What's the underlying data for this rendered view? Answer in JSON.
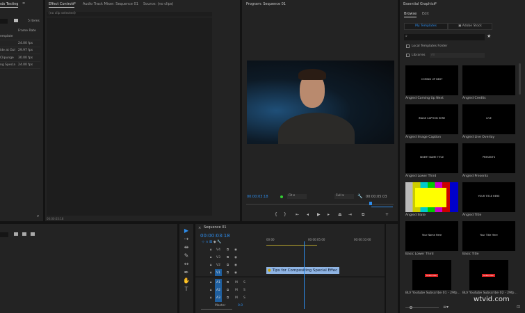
{
  "project": {
    "title": "Pinds Testing",
    "items_count": "5 items",
    "column_frame_rate": "Frame Rate",
    "rows": [
      {
        "name": "emplate",
        "fps": ""
      },
      {
        "name": "",
        "fps": "24.00 fps"
      },
      {
        "name": "ide at Gol",
        "fps": "29.97 fps"
      },
      {
        "name": "Clipunge",
        "fps": "30.00 fps"
      },
      {
        "name": "ng Specia",
        "fps": "24.00 fps"
      }
    ]
  },
  "effect_controls": {
    "tabs": [
      "Effect Controls",
      "Audio Track Mixer: Sequence 01",
      "Source: (no clips)"
    ],
    "no_clip": "(no clip selected)",
    "timecode": "00:00:03:18"
  },
  "program": {
    "title": "Program: Sequence 01",
    "timecode": "00:00:03:18",
    "fit": "Fit",
    "quality": "Full",
    "duration": "00:00:05:03"
  },
  "essential_graphics": {
    "title": "Essential Graphics",
    "tabs": [
      "Browse",
      "Edit"
    ],
    "buttons": [
      "My Templates",
      "Adobe Stock"
    ],
    "search_placeholder": "",
    "local_folder": "Local Templates Folder",
    "libraries": "Libraries",
    "libraries_value": "All",
    "templates": [
      {
        "name": "Angled Coming Up Next",
        "thumb_text": "COMING UP NEXT"
      },
      {
        "name": "Angled Credits",
        "thumb_text": ""
      },
      {
        "name": "Angled Image Caption",
        "thumb_text": "IMAGE CAPTION HERE"
      },
      {
        "name": "Angled Live Overlay",
        "thumb_text": "LIVE"
      },
      {
        "name": "Angled Lower Third",
        "thumb_text": "INSERT NAME TITLE"
      },
      {
        "name": "Angled Presents",
        "thumb_text": "PRESENTS"
      },
      {
        "name": "Angled Slate",
        "thumb_text": ""
      },
      {
        "name": "Angled Title",
        "thumb_text": "YOUR TITLE HERE"
      },
      {
        "name": "Basic Lower Third",
        "thumb_text": "Your Name Here"
      },
      {
        "name": "Basic Title",
        "thumb_text": "Your Title Here"
      },
      {
        "name": "BLV Youtube Subscribe 01 - 29fp...",
        "thumb_text": "Subscribe"
      },
      {
        "name": "BLV Youtube Subscribe 02 - 29fp...",
        "thumb_text": "Subscribe"
      }
    ]
  },
  "timeline": {
    "title": "Sequence 01",
    "timecode": "00:00:03:18",
    "ruler": [
      "00:00",
      "00:00:05:00",
      "00:00:10:00"
    ],
    "video_tracks": [
      "V4",
      "V3",
      "V2",
      "V1"
    ],
    "audio_tracks": [
      "A1",
      "A2",
      "A3"
    ],
    "master": "Master",
    "master_value": "0.0",
    "clip": "Tips for Compositing Special Effec",
    "playhead_fraction": 0.36
  },
  "watermark": "wtvid.com",
  "colors": {
    "accent": "#2d8ceb",
    "clip": "#8fb4e3"
  }
}
